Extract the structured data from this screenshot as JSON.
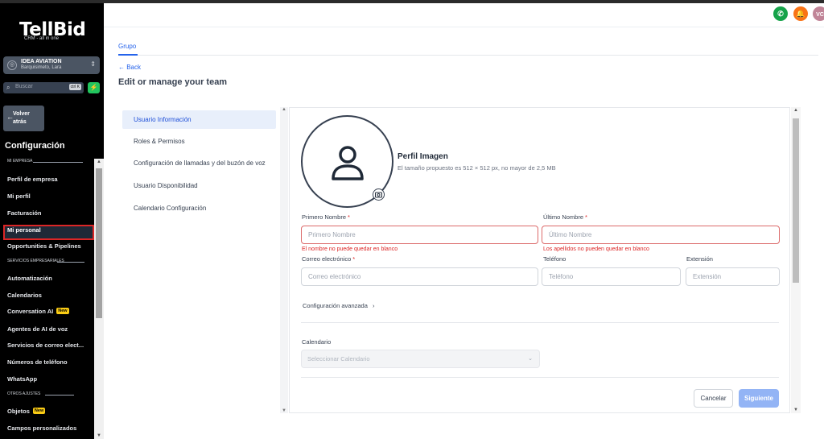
{
  "brand": {
    "name": "TellBid",
    "tagline": "CRM - all in one"
  },
  "account": {
    "name": "IDEA AVIATION",
    "location": "Barquisimeto, Lara"
  },
  "search": {
    "placeholder": "Buscar",
    "shortcut": "ctrl K"
  },
  "back_button": {
    "label_line1": "Volver",
    "label_line2": "atrás"
  },
  "sidebar": {
    "title": "Configuración",
    "sections": [
      {
        "heading": "MI EMPRESA"
      },
      {
        "heading": "SERVICIOS EMPRESARIALES"
      },
      {
        "heading": "OTROS AJUSTES"
      }
    ],
    "items": [
      {
        "label": "Perfil de empresa"
      },
      {
        "label": "Mi perfil"
      },
      {
        "label": "Facturación"
      },
      {
        "label": "Mi personal"
      },
      {
        "label": "Opportunities & Pipelines"
      },
      {
        "label": "Automatización"
      },
      {
        "label": "Calendarios"
      },
      {
        "label": "Conversation AI",
        "badge": "New"
      },
      {
        "label": "Agentes de AI de voz"
      },
      {
        "label": "Servicios de correo elect..."
      },
      {
        "label": "Números de teléfono"
      },
      {
        "label": "WhatsApp"
      },
      {
        "label": "Objetos",
        "badge": "New"
      },
      {
        "label": "Campos personalizados"
      }
    ]
  },
  "header": {
    "user_initials": "VC"
  },
  "tabs": {
    "active": "Grupo"
  },
  "breadcrumb": {
    "back": "← Back"
  },
  "page": {
    "title": "Edit or manage your team"
  },
  "settings_nav": [
    {
      "label": "Usuario Información"
    },
    {
      "label": "Roles & Permisos"
    },
    {
      "label": "Configuración de llamadas y del buzón de voz"
    },
    {
      "label": "Usuario Disponibilidad"
    },
    {
      "label": "Calendario Configuración"
    }
  ],
  "profile": {
    "title": "Perfil Imagen",
    "hint": "El tamaño propuesto es 512 × 512 px, no mayor de 2,5 MB"
  },
  "form": {
    "first_name": {
      "label": "Primero Nombre",
      "required": "*",
      "placeholder": "Primero Nombre",
      "error": "El nombre no puede quedar en blanco"
    },
    "last_name": {
      "label": "Último Nombre",
      "required": "*",
      "placeholder": "Último Nombre",
      "error": "Los apellidos no pueden quedar en blanco"
    },
    "email": {
      "label": "Correo electrónico",
      "required": "*",
      "placeholder": "Correo electrónico"
    },
    "phone": {
      "label": "Teléfono",
      "placeholder": "Teléfono"
    },
    "extension": {
      "label": "Extensión",
      "placeholder": "Extensión"
    },
    "advanced": "Configuración avanzada",
    "calendar": {
      "label": "Calendario",
      "placeholder": "Seleccionar Calendario"
    }
  },
  "buttons": {
    "cancel": "Cancelar",
    "next": "Siguiente"
  },
  "colors": {
    "accent": "#2563eb",
    "error": "#dc2626",
    "sidebar_bg": "#000000"
  }
}
